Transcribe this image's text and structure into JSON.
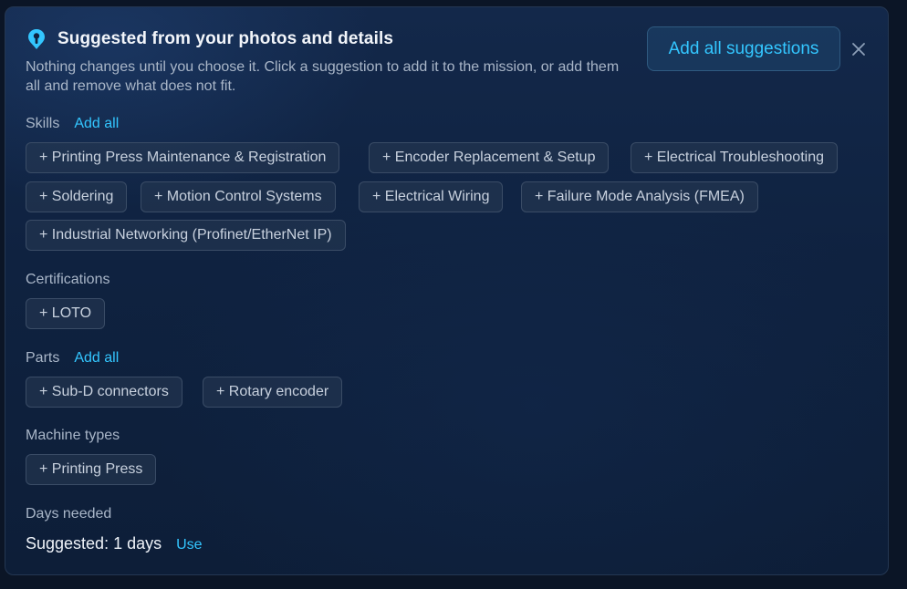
{
  "header": {
    "title": "Suggested from your photos and details",
    "subtitle": "Nothing changes until you choose it. Click a suggestion to add it to the mission, or add them all and remove what does not fit.",
    "add_all_label": "Add all suggestions",
    "close_icon": "close-icon",
    "logo_icon": "pin-icon"
  },
  "colors": {
    "accent": "#33c6ff",
    "panel_bg": "#0f2240",
    "chip_bg": "#283a54",
    "text_primary": "#f2f5fa",
    "text_secondary": "#a9b6c8"
  },
  "skills": {
    "label": "Skills",
    "add_all": "Add all",
    "items": [
      "+ Printing Press Maintenance & Registration",
      "+ Encoder Replacement & Setup",
      "+ Electrical Troubleshooting",
      "+ Soldering",
      "+ Motion Control Systems",
      "+ Electrical Wiring",
      "+ Failure Mode Analysis (FMEA)",
      "+ Industrial Networking (Profinet/EtherNet IP)"
    ]
  },
  "certifications": {
    "label": "Certifications",
    "items": [
      "+ LOTO"
    ]
  },
  "parts": {
    "label": "Parts",
    "add_all": "Add all",
    "items": [
      "+ Sub-D connectors",
      "+ Rotary encoder"
    ]
  },
  "machine_types": {
    "label": "Machine types",
    "items": [
      "+ Printing Press"
    ]
  },
  "days": {
    "label": "Days needed",
    "suggested": "Suggested: 1 days",
    "use_label": "Use"
  }
}
